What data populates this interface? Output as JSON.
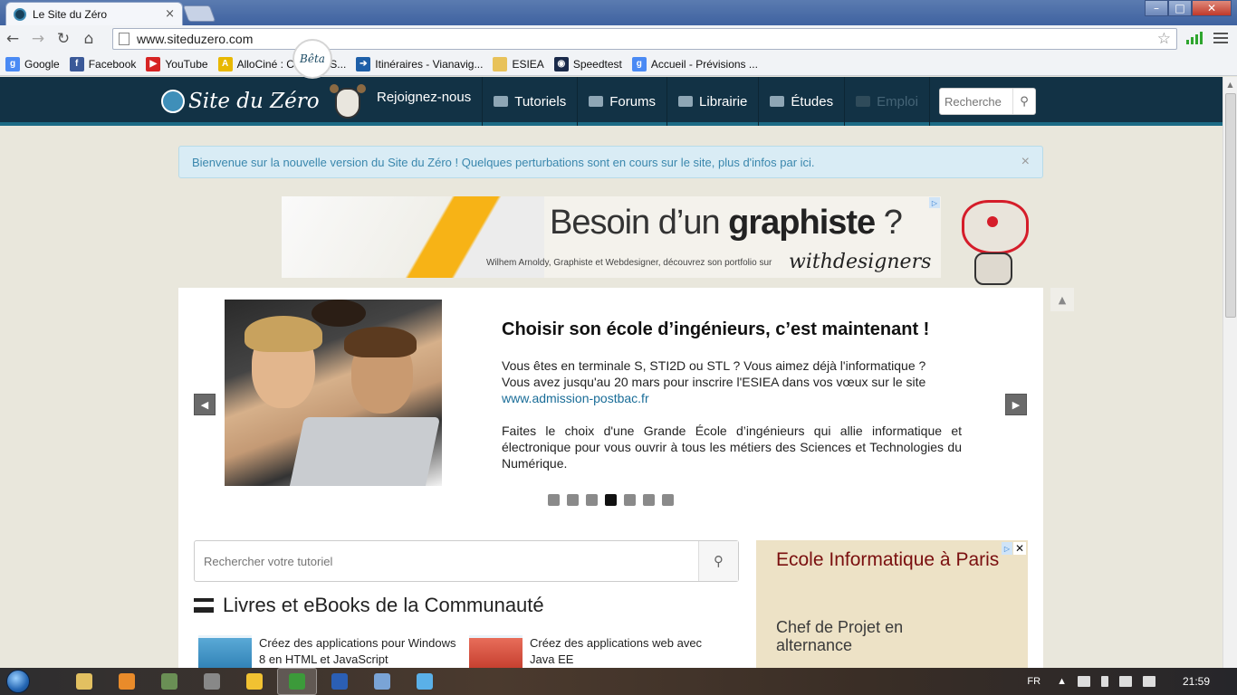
{
  "browser": {
    "tab_title": "Le Site du Zéro",
    "tab_close": "×",
    "url": "www.siteduzero.com",
    "window_controls": {
      "minimize": "–",
      "maximize": "□",
      "close": "✕"
    },
    "bookmarks": [
      {
        "label": "Google",
        "icon": "google-icon",
        "color": "#4a8af4",
        "glyph": "g"
      },
      {
        "label": "Facebook",
        "icon": "facebook-icon",
        "color": "#3b5998",
        "glyph": "f"
      },
      {
        "label": "YouTube",
        "icon": "youtube-icon",
        "color": "#d62424",
        "glyph": "▶"
      },
      {
        "label": "AlloCiné : Cinéma, S...",
        "icon": "allocine-icon",
        "color": "#e8b800",
        "glyph": "A"
      },
      {
        "label": "Itinéraires - Vianavig...",
        "icon": "vianavigo-icon",
        "color": "#1e5fa8",
        "glyph": "➔"
      },
      {
        "label": "ESIEA",
        "icon": "folder-icon",
        "color": "#e8c25a",
        "glyph": ""
      },
      {
        "label": "Speedtest",
        "icon": "speedtest-icon",
        "color": "#1a2a4a",
        "glyph": "◉"
      },
      {
        "label": "Accueil - Prévisions ...",
        "icon": "google-icon",
        "color": "#4a8af4",
        "glyph": "g"
      }
    ]
  },
  "site": {
    "logo_text": "Site du Zéro",
    "beta_label": "Bêta",
    "join_label": "Rejoignez-nous",
    "nav": [
      {
        "label": "Tutoriels",
        "icon": "tutorials-icon",
        "enabled": true
      },
      {
        "label": "Forums",
        "icon": "forums-icon",
        "enabled": true
      },
      {
        "label": "Librairie",
        "icon": "library-icon",
        "enabled": true
      },
      {
        "label": "Études",
        "icon": "graduation-cap-icon",
        "enabled": true
      },
      {
        "label": "Emploi",
        "icon": "job-icon",
        "enabled": false
      }
    ],
    "search_placeholder": "Recherche",
    "alert_text": "Bienvenue sur la nouvelle version du Site du Zéro ! Quelques perturbations sont en cours sur le site, plus d'infos par ici.",
    "alert_close": "×",
    "banner": {
      "title_prefix": "Besoin d’un ",
      "title_bold": "graphiste",
      "title_suffix": " ?",
      "subtitle": "Wilhem Arnoldy, Graphiste et Webdesigner, découvrez son portfolio sur",
      "brand": "withdesigners"
    },
    "slider": {
      "title": "Choisir son école d’ingénieurs, c’est maintenant !",
      "p1_line1": "Vous êtes en terminale S, STI2D ou STL ? Vous aimez déjà l'informatique ?",
      "p1_line2": "Vous avez jusqu'au 20 mars pour inscrire l'ESIEA dans vos vœux sur le site",
      "p1_link": "www.admission-postbac.fr",
      "p2": "Faites le choix d'une Grande École d’ingénieurs qui allie informatique et électronique pour vous ouvrir à tous les métiers des Sciences et Technologies du Numérique.",
      "dot_count": 7,
      "active_dot": 4,
      "prev_arrow": "◀",
      "next_arrow": "▶"
    },
    "tutorial_search_placeholder": "Rechercher votre tutoriel",
    "books_heading": "Livres et eBooks de la Communauté",
    "books": [
      {
        "title": "Créez des applications pour Windows 8 en HTML et JavaScript",
        "cover_color": "blue"
      },
      {
        "title": "Créez des applications web avec Java EE",
        "cover_color": "red"
      }
    ],
    "side_ad": {
      "title": "Ecole Informatique à Paris",
      "subtitle": "Chef de Projet en alternance",
      "close": "✕",
      "choice": "▷"
    }
  },
  "taskbar": {
    "language": "FR",
    "clock": "21:59",
    "apps": [
      {
        "name": "explorer-icon",
        "color": "#e2c061"
      },
      {
        "name": "media-player-icon",
        "color": "#e98b2a"
      },
      {
        "name": "app-3-icon",
        "color": "#6a8f55"
      },
      {
        "name": "app-4-icon",
        "color": "#888"
      },
      {
        "name": "app-5-icon",
        "color": "#f1c232"
      },
      {
        "name": "chrome-icon",
        "color": "#3c9a3a",
        "active": true
      },
      {
        "name": "word-icon",
        "color": "#2b5fb4"
      },
      {
        "name": "app-8-icon",
        "color": "#7aa4d6"
      },
      {
        "name": "itunes-icon",
        "color": "#5ab0e8"
      }
    ]
  }
}
